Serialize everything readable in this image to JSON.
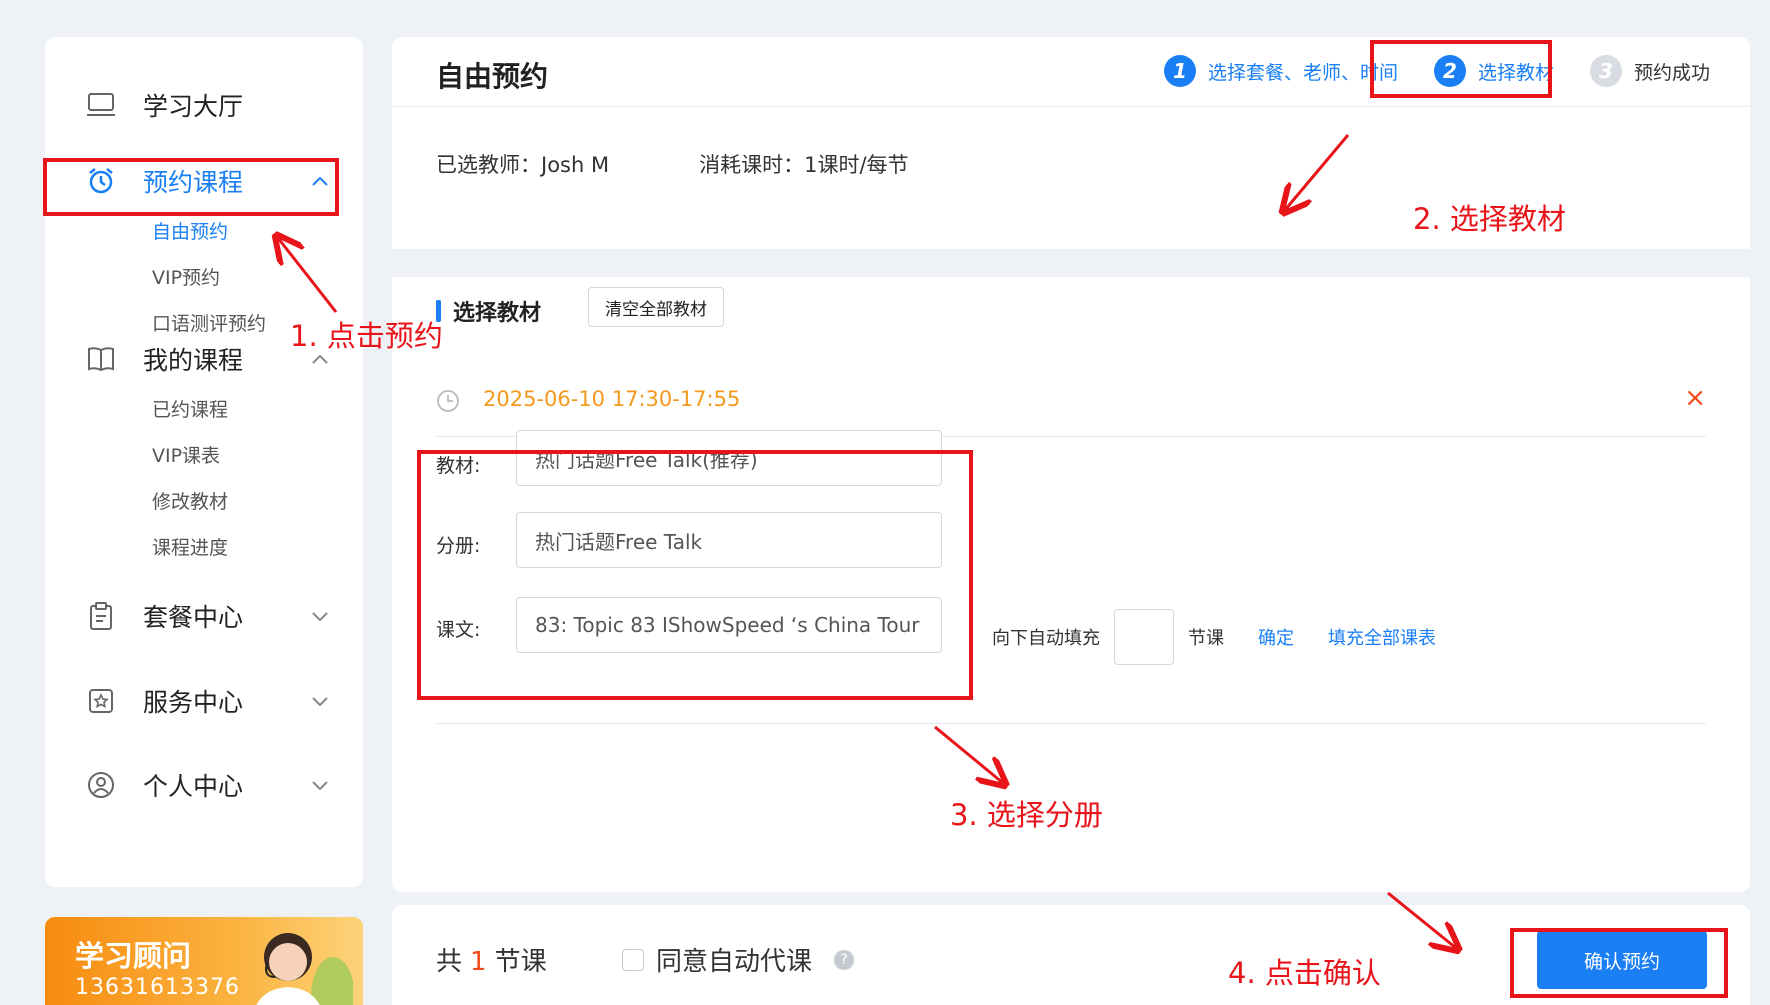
{
  "sidebar": {
    "groups": [
      {
        "label": "学习大厅",
        "icon": "laptop-icon",
        "expanded": null
      },
      {
        "label": "预约课程",
        "icon": "alarm-clock-icon",
        "expanded": true,
        "items": [
          "自由预约",
          "VIP预约",
          "口语测评预约"
        ]
      },
      {
        "label": "我的课程",
        "icon": "open-book-icon",
        "expanded": true,
        "items": [
          "已约课程",
          "VIP课表",
          "修改教材",
          "课程进度"
        ]
      },
      {
        "label": "套餐中心",
        "icon": "clipboard-icon",
        "expanded": false
      },
      {
        "label": "服务中心",
        "icon": "star-badge-icon",
        "expanded": false
      },
      {
        "label": "个人中心",
        "icon": "user-circle-icon",
        "expanded": false
      }
    ],
    "active_item": "自由预约"
  },
  "advisor": {
    "title": "学习顾问",
    "phone": "13631613376"
  },
  "header": {
    "title": "自由预约",
    "steps": [
      {
        "num": "1",
        "label": "选择套餐、老师、时间",
        "state": "done"
      },
      {
        "num": "2",
        "label": "选择教材",
        "state": "current"
      },
      {
        "num": "3",
        "label": "预约成功",
        "state": "todo"
      }
    ]
  },
  "info": {
    "teacher": "已选教师：Josh M",
    "cost": "消耗课时：1课时/每节"
  },
  "section": {
    "title": "选择教材",
    "clear_button": "清空全部教材"
  },
  "slot": {
    "time": "2025-06-10 17:30-17:55",
    "close": "×"
  },
  "form": {
    "textbook_label": "教材:",
    "textbook_value": "热门话题Free Talk(推荐)",
    "volume_label": "分册:",
    "volume_value": "热门话题Free Talk",
    "lesson_label": "课文:",
    "lesson_value": "83: Topic 83 IShowSpeed ‘s China Tour"
  },
  "autofill": {
    "prefix": "向下自动填充",
    "suffix": "节课",
    "confirm": "确定",
    "fill_all": "填充全部课表"
  },
  "footer": {
    "total_prefix": "共",
    "total_count": "1",
    "total_suffix": "节课",
    "agree_label": "同意自动代课",
    "help": "?",
    "confirm_button": "确认预约"
  },
  "annotations": {
    "step1": "1. 点击预约",
    "step2": "2. 选择教材",
    "step3": "3. 选择分册",
    "step4": "4. 点击确认"
  },
  "colors": {
    "accent": "#1a7ff5",
    "annotation": "#e8141a",
    "slot_time": "#f39a1e",
    "close": "#f04a1a"
  }
}
